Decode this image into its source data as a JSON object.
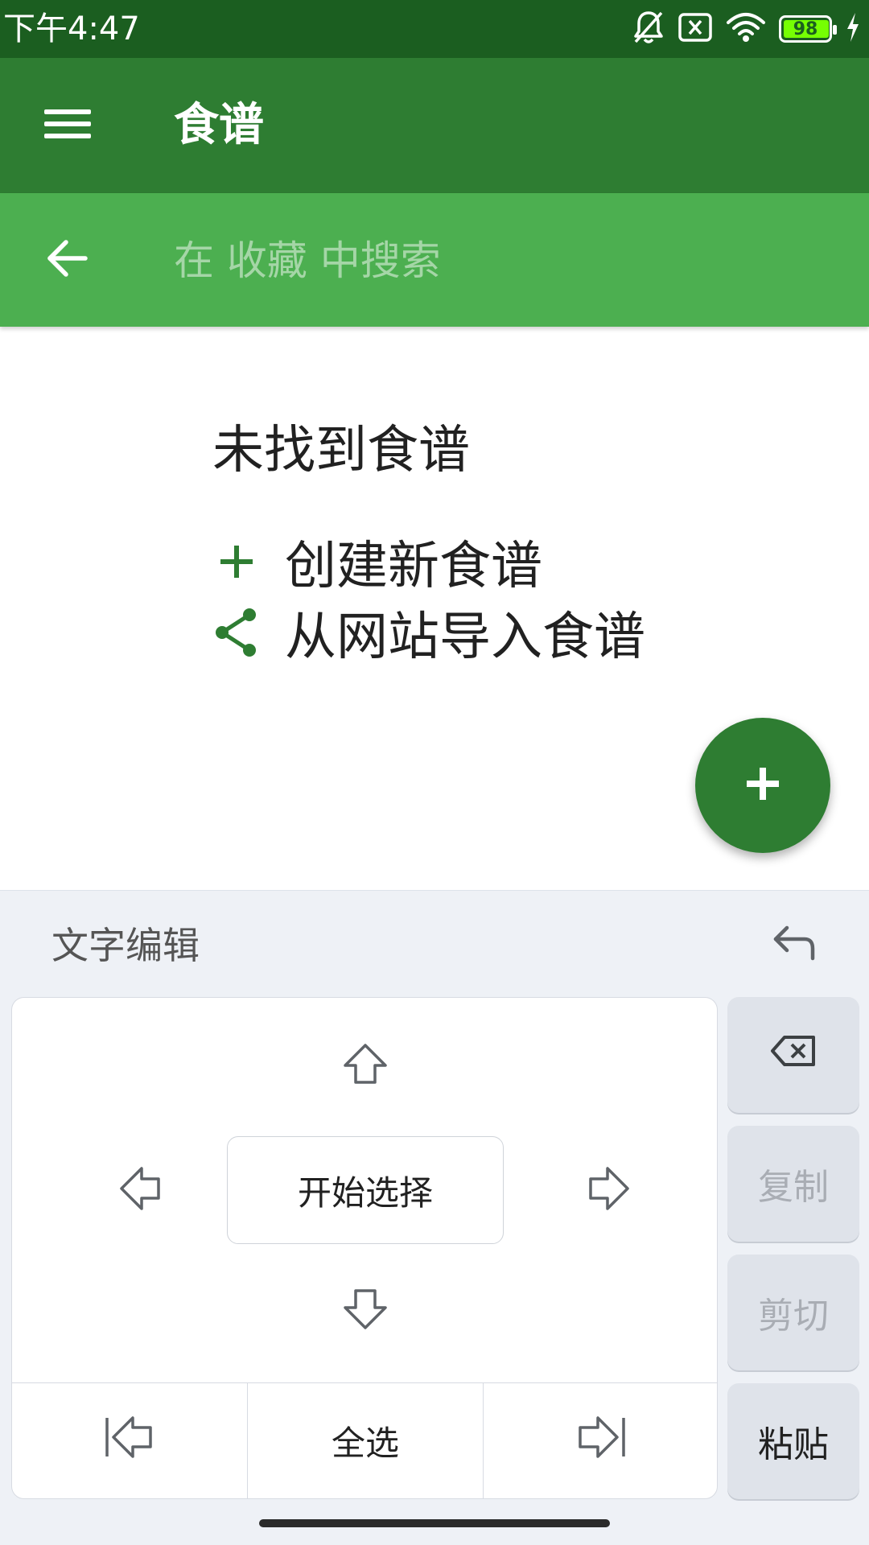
{
  "status_bar": {
    "time": "下午4:47",
    "battery": "98",
    "icons": [
      "notifications-off-icon",
      "no-sim-icon",
      "wifi-icon",
      "battery-icon",
      "charging-bolt-icon"
    ]
  },
  "app_bar": {
    "title": "食谱",
    "menu_icon": "menu-icon"
  },
  "search": {
    "placeholder": "在 收藏 中搜索",
    "value": "",
    "back_icon": "arrow-back-icon"
  },
  "empty_state": {
    "title": "未找到食谱",
    "actions": [
      {
        "icon": "plus-icon",
        "label": "创建新食谱"
      },
      {
        "icon": "share-icon",
        "label": "从网站导入食谱"
      }
    ]
  },
  "fab": {
    "icon": "add-icon"
  },
  "keyboard_panel": {
    "title": "文字编辑",
    "undo_icon": "undo-icon",
    "start_select": "开始选择",
    "select_all": "全选",
    "side_keys": {
      "backspace_icon": "backspace-icon",
      "copy": "复制",
      "cut": "剪切",
      "paste": "粘贴"
    }
  },
  "colors": {
    "status_bar": "#1b5e20",
    "app_bar": "#2e7d32",
    "search_bar": "#4caf50",
    "accent": "#2e7d32",
    "keyboard_bg": "#eef1f6"
  }
}
